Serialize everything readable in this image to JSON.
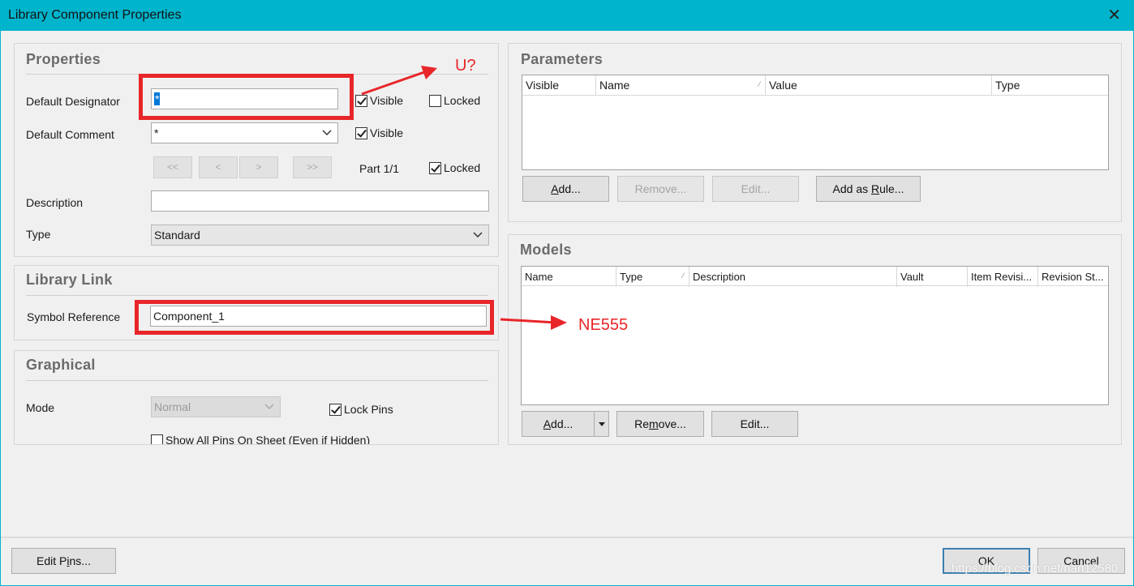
{
  "window": {
    "title": "Library Component Properties",
    "close_glyph": "✕"
  },
  "properties": {
    "title": "Properties",
    "default_designator": {
      "label": "Default Designator",
      "value": "*",
      "visible_label": "Visible",
      "visible": true,
      "locked_label": "Locked",
      "locked": false
    },
    "default_comment": {
      "label": "Default Comment",
      "value": "*",
      "visible_label": "Visible",
      "visible": true
    },
    "part_nav": {
      "first": "<<",
      "prev": "<",
      "next": ">",
      "last": ">>",
      "part_label": "Part 1/1",
      "locked_label": "Locked",
      "locked": true
    },
    "description": {
      "label": "Description",
      "value": ""
    },
    "type": {
      "label": "Type",
      "value": "Standard"
    }
  },
  "library_link": {
    "title": "Library Link",
    "symbol_reference": {
      "label": "Symbol Reference",
      "value": "Component_1"
    }
  },
  "graphical": {
    "title": "Graphical",
    "mode": {
      "label": "Mode",
      "value": "Normal"
    },
    "lock_pins": {
      "label": "Lock Pins",
      "checked": true
    },
    "show_all_pins": {
      "label": "Show All Pins On Sheet (Even if Hidden)",
      "checked": false
    }
  },
  "parameters": {
    "title": "Parameters",
    "columns": [
      "Visible",
      "Name",
      "Value",
      "Type"
    ],
    "rows": [],
    "buttons": {
      "add_pre": "",
      "add_key": "A",
      "add_post": "dd...",
      "remove": "Remove...",
      "edit": "Edit...",
      "add_rule_pre": "Add as ",
      "add_rule_key": "R",
      "add_rule_post": "ule..."
    }
  },
  "models": {
    "title": "Models",
    "columns": [
      "Name",
      "Type",
      "Description",
      "Vault",
      "Item Revisi...",
      "Revision St..."
    ],
    "rows": [],
    "buttons": {
      "add_pre": "",
      "add_key": "A",
      "add_post": "dd...",
      "remove_pre": "Re",
      "remove_key": "m",
      "remove_post": "ove...",
      "edit_pre": "Edit...",
      "edit_key": "",
      "edit_post": ""
    }
  },
  "footer": {
    "edit_pins_pre": "Edit P",
    "edit_pins_key": "i",
    "edit_pins_post": "ns...",
    "ok": "OK",
    "cancel": "Cancel"
  },
  "annotations": {
    "designator_note": "U?",
    "symbol_note": "NE555",
    "color": "#e8262a"
  },
  "watermark": "https://blog.csdn.net/nan12580"
}
